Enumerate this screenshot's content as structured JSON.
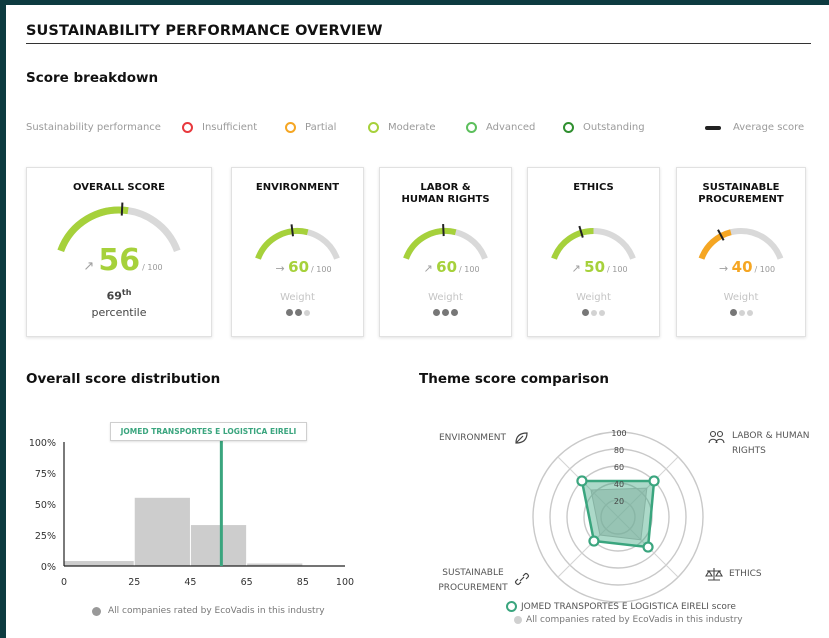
{
  "page_title": "SUSTAINABILITY PERFORMANCE OVERVIEW",
  "score_breakdown": {
    "heading": "Score breakdown",
    "legend": {
      "label": "Sustainability performance",
      "items": [
        {
          "label": "Insufficient",
          "color": "#e8383d"
        },
        {
          "label": "Partial",
          "color": "#f5a623"
        },
        {
          "label": "Moderate",
          "color": "#a6d13b"
        },
        {
          "label": "Advanced",
          "color": "#5cbf5c"
        },
        {
          "label": "Outstanding",
          "color": "#2f8f2f"
        }
      ],
      "average_label": "Average score"
    },
    "cards": [
      {
        "title": "OVERALL SCORE",
        "score": "56",
        "out_of": "/ 100",
        "value": 56,
        "average": 52,
        "color": "#a6d13b",
        "trend": "↗",
        "percentile_num": "69",
        "percentile_sup": "th",
        "percentile_label": "percentile"
      },
      {
        "title": "ENVIRONMENT",
        "score": "60",
        "out_of": "/ 100",
        "value": 60,
        "average": 45,
        "color": "#a6d13b",
        "trend": "→",
        "weight_label": "Weight",
        "weight": 2
      },
      {
        "title": "LABOR & HUMAN RIGHTS",
        "score": "60",
        "out_of": "/ 100",
        "value": 60,
        "average": 48,
        "color": "#a6d13b",
        "trend": "↗",
        "weight_label": "Weight",
        "weight": 3
      },
      {
        "title": "ETHICS",
        "score": "50",
        "out_of": "/ 100",
        "value": 50,
        "average": 38,
        "color": "#a6d13b",
        "trend": "↗",
        "weight_label": "Weight",
        "weight": 1
      },
      {
        "title": "SUSTAINABLE PROCUREMENT",
        "score": "40",
        "out_of": "/ 100",
        "value": 40,
        "average": 30,
        "color": "#f5a623",
        "trend": "→",
        "weight_label": "Weight",
        "weight": 1
      }
    ]
  },
  "distribution": {
    "heading": "Overall score distribution",
    "company_label": "JOMED TRANSPORTES E LOGISTICA EIRELI",
    "footer": "All companies rated by EcoVadis in this industry"
  },
  "comparison": {
    "heading": "Theme score comparison",
    "axis_labels": [
      "ENVIRONMENT",
      "LABOR & HUMAN RIGHTS",
      "ETHICS",
      "SUSTAINABLE PROCUREMENT"
    ],
    "footer_company": "JOMED TRANSPORTES E LOGISTICA EIRELI score",
    "footer_all": "All companies rated by EcoVadis in this industry"
  },
  "chart_data": [
    {
      "type": "bar",
      "categories": [
        "0-25",
        "25-45",
        "45-65",
        "65-85",
        "85-100"
      ],
      "values": [
        4,
        55,
        33,
        2,
        0
      ],
      "x_ticks": [
        "0",
        "25",
        "45",
        "65",
        "85",
        "100"
      ],
      "y_ticks": [
        "0%",
        "25%",
        "50%",
        "75%",
        "100%"
      ],
      "ylim": [
        0,
        100
      ],
      "xlim": [
        0,
        100
      ],
      "marker_value": 56
    },
    {
      "type": "radar",
      "axes": [
        "ENVIRONMENT",
        "LABOR & HUMAN RIGHTS",
        "ETHICS",
        "SUSTAINABLE PROCUREMENT"
      ],
      "rings": [
        "20",
        "40",
        "60",
        "80",
        "100"
      ],
      "series": [
        {
          "name": "JOMED TRANSPORTES E LOGISTICA EIRELI score",
          "values": [
            60,
            60,
            50,
            40
          ]
        },
        {
          "name": "All companies rated by EcoVadis in this industry",
          "values": [
            45,
            48,
            38,
            30
          ]
        }
      ],
      "max": 100
    }
  ]
}
